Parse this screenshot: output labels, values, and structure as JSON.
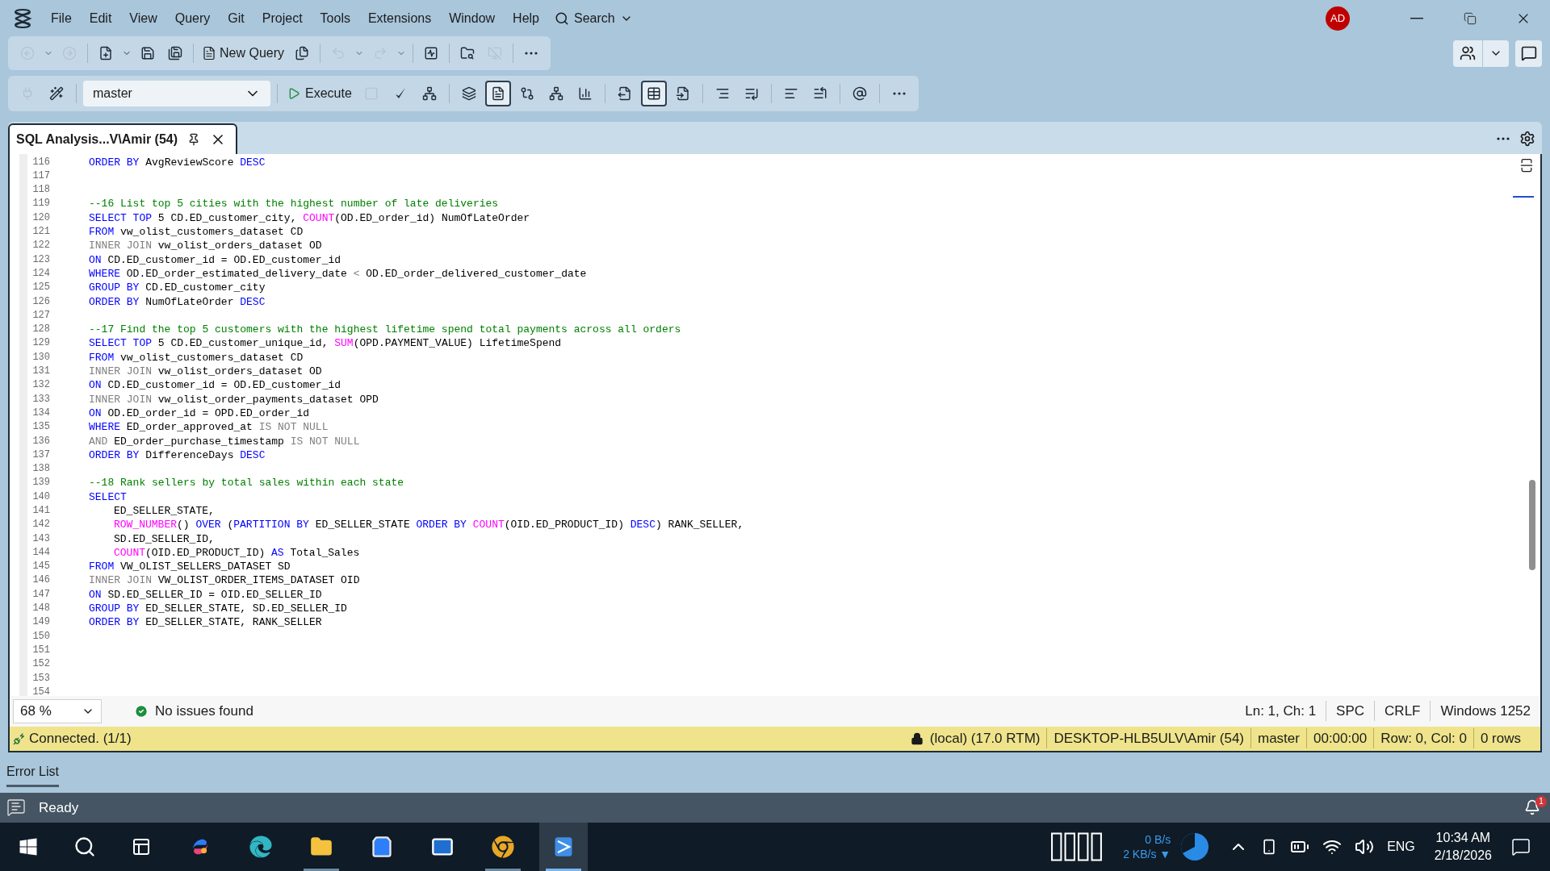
{
  "menu": [
    "File",
    "Edit",
    "View",
    "Query",
    "Git",
    "Project",
    "Tools",
    "Extensions",
    "Window",
    "Help"
  ],
  "search_label": "Search",
  "avatar": "AD",
  "main_toolbar": {
    "tools_before": [
      {
        "disabled": true
      },
      {
        "disabled": true
      },
      {
        "disabled": true
      },
      {
        "disabled": false
      },
      {
        "disabled": false
      },
      {
        "disabled": false
      },
      {
        "disabled": false
      }
    ],
    "new_query": "New Query",
    "tools_after": [
      {
        "disabled": false
      },
      {
        "disabled": true
      },
      {
        "disabled": true
      },
      {
        "disabled": true
      },
      {
        "disabled": true
      },
      {
        "disabled": false
      },
      {
        "disabled": false
      },
      {
        "disabled": true
      },
      {
        "disabled": false
      }
    ]
  },
  "query_toolbar": {
    "leading_tools": [
      {
        "disabled": true
      },
      {
        "disabled": false
      }
    ],
    "database": "master",
    "execute": "Execute",
    "tools": [
      {
        "selected": false,
        "disabled": true
      },
      {
        "selected": false,
        "disabled": false
      },
      {
        "selected": false,
        "disabled": false
      },
      {
        "selected": false,
        "disabled": false
      },
      {
        "selected": true,
        "disabled": false
      },
      {
        "selected": false,
        "disabled": false
      },
      {
        "selected": false,
        "disabled": false
      },
      {
        "selected": false,
        "disabled": false
      },
      {
        "selected": false,
        "disabled": false
      },
      {
        "selected": true,
        "disabled": false
      },
      {
        "selected": false,
        "disabled": false
      },
      {
        "selected": false,
        "disabled": false
      },
      {
        "selected": false,
        "disabled": false
      },
      {
        "selected": false,
        "disabled": false
      },
      {
        "selected": false,
        "disabled": false
      },
      {
        "selected": false,
        "disabled": false
      },
      {
        "selected": false,
        "disabled": false
      }
    ]
  },
  "tab": {
    "title": "SQL Analysis...V\\Amir (54)",
    "selected": true
  },
  "editor": {
    "lines": [
      {
        "number": "116",
        "tokens": [
          {
            "kind": "keyword",
            "text": "ORDER BY"
          },
          {
            "kind": "text",
            "text": " AvgReviewScore "
          },
          {
            "kind": "keyword",
            "text": "DESC"
          }
        ]
      },
      {
        "number": "117"
      },
      {
        "number": "118"
      },
      {
        "number": "119",
        "tokens": [
          {
            "kind": "comment",
            "text": "--16 List top 5 cities with the highest number of late deliveries"
          }
        ]
      },
      {
        "number": "120",
        "tokens": [
          {
            "kind": "keyword",
            "text": "SELECT TOP"
          },
          {
            "kind": "text",
            "text": " 5 CD.ED_customer_city, "
          },
          {
            "kind": "function",
            "text": "COUNT"
          },
          {
            "kind": "text",
            "text": "(OD.ED_order_id) NumOfLateOrder"
          }
        ]
      },
      {
        "number": "121",
        "tokens": [
          {
            "kind": "keyword",
            "text": "FROM"
          },
          {
            "kind": "text",
            "text": " vw_olist_customers_dataset CD"
          }
        ]
      },
      {
        "number": "122",
        "tokens": [
          {
            "kind": "operator",
            "text": "INNER JOIN"
          },
          {
            "kind": "text",
            "text": " vw_olist_orders_dataset OD"
          }
        ]
      },
      {
        "number": "123",
        "tokens": [
          {
            "kind": "keyword",
            "text": "ON"
          },
          {
            "kind": "text",
            "text": " CD.ED_customer_id = OD.ED_customer_id"
          }
        ]
      },
      {
        "number": "124",
        "tokens": [
          {
            "kind": "keyword",
            "text": "WHERE"
          },
          {
            "kind": "text",
            "text": " OD.ED_order_estimated_delivery_date "
          },
          {
            "kind": "operator",
            "text": "<"
          },
          {
            "kind": "text",
            "text": " OD.ED_order_delivered_customer_date"
          }
        ]
      },
      {
        "number": "125",
        "tokens": [
          {
            "kind": "keyword",
            "text": "GROUP BY"
          },
          {
            "kind": "text",
            "text": " CD.ED_customer_city"
          }
        ]
      },
      {
        "number": "126",
        "tokens": [
          {
            "kind": "keyword",
            "text": "ORDER BY"
          },
          {
            "kind": "text",
            "text": " NumOfLateOrder "
          },
          {
            "kind": "keyword",
            "text": "DESC"
          }
        ]
      },
      {
        "number": "127"
      },
      {
        "number": "128",
        "tokens": [
          {
            "kind": "comment",
            "text": "--17 Find the top 5 customers with the highest lifetime spend total payments across all orders"
          }
        ]
      },
      {
        "number": "129",
        "tokens": [
          {
            "kind": "keyword",
            "text": "SELECT TOP"
          },
          {
            "kind": "text",
            "text": " 5 CD.ED_customer_unique_id, "
          },
          {
            "kind": "function",
            "text": "SUM"
          },
          {
            "kind": "text",
            "text": "(OPD.PAYMENT_VALUE) LifetimeSpend"
          }
        ]
      },
      {
        "number": "130",
        "tokens": [
          {
            "kind": "keyword",
            "text": "FROM"
          },
          {
            "kind": "text",
            "text": " vw_olist_customers_dataset CD"
          }
        ]
      },
      {
        "number": "131",
        "tokens": [
          {
            "kind": "operator",
            "text": "INNER JOIN"
          },
          {
            "kind": "text",
            "text": " vw_olist_orders_dataset OD"
          }
        ]
      },
      {
        "number": "132",
        "tokens": [
          {
            "kind": "keyword",
            "text": "ON"
          },
          {
            "kind": "text",
            "text": " CD.ED_customer_id = OD.ED_customer_id"
          }
        ]
      },
      {
        "number": "133",
        "tokens": [
          {
            "kind": "operator",
            "text": "INNER JOIN"
          },
          {
            "kind": "text",
            "text": " vw_olist_order_payments_dataset OPD"
          }
        ]
      },
      {
        "number": "134",
        "tokens": [
          {
            "kind": "keyword",
            "text": "ON"
          },
          {
            "kind": "text",
            "text": " OD.ED_order_id = OPD.ED_order_id"
          }
        ]
      },
      {
        "number": "135",
        "tokens": [
          {
            "kind": "keyword",
            "text": "WHERE"
          },
          {
            "kind": "text",
            "text": " ED_order_approved_at "
          },
          {
            "kind": "operator",
            "text": "IS NOT NULL"
          }
        ]
      },
      {
        "number": "136",
        "tokens": [
          {
            "kind": "operator",
            "text": "AND"
          },
          {
            "kind": "text",
            "text": " ED_order_purchase_timestamp "
          },
          {
            "kind": "operator",
            "text": "IS NOT NULL"
          }
        ]
      },
      {
        "number": "137",
        "tokens": [
          {
            "kind": "keyword",
            "text": "ORDER BY"
          },
          {
            "kind": "text",
            "text": " DifferenceDays "
          },
          {
            "kind": "keyword",
            "text": "DESC"
          }
        ]
      },
      {
        "number": "138"
      },
      {
        "number": "139",
        "tokens": [
          {
            "kind": "comment",
            "text": "--18 Rank sellers by total sales within each state"
          }
        ]
      },
      {
        "number": "140",
        "tokens": [
          {
            "kind": "keyword",
            "text": "SELECT"
          }
        ]
      },
      {
        "number": "141",
        "indented": true,
        "tokens": [
          {
            "kind": "text",
            "text": "ED_SELLER_STATE,"
          }
        ]
      },
      {
        "number": "142",
        "indented": true,
        "tokens": [
          {
            "kind": "function",
            "text": "ROW_NUMBER"
          },
          {
            "kind": "text",
            "text": "() "
          },
          {
            "kind": "keyword",
            "text": "OVER"
          },
          {
            "kind": "text",
            "text": " ("
          },
          {
            "kind": "keyword",
            "text": "PARTITION BY"
          },
          {
            "kind": "text",
            "text": " ED_SELLER_STATE "
          },
          {
            "kind": "keyword",
            "text": "ORDER BY"
          },
          {
            "kind": "function",
            "text": " COUNT"
          },
          {
            "kind": "text",
            "text": "(OID.ED_PRODUCT_ID) "
          },
          {
            "kind": "keyword",
            "text": "DESC"
          },
          {
            "kind": "text",
            "text": ") RANK_SELLER,"
          }
        ]
      },
      {
        "number": "143",
        "indented": true,
        "tokens": [
          {
            "kind": "text",
            "text": "SD.ED_SELLER_ID,"
          }
        ]
      },
      {
        "number": "144",
        "indented": true,
        "tokens": [
          {
            "kind": "function",
            "text": "COUNT"
          },
          {
            "kind": "text",
            "text": "(OID.ED_PRODUCT_ID) "
          },
          {
            "kind": "keyword",
            "text": "AS"
          },
          {
            "kind": "text",
            "text": " Total_Sales"
          }
        ]
      },
      {
        "number": "145",
        "tokens": [
          {
            "kind": "keyword",
            "text": "FROM"
          },
          {
            "kind": "text",
            "text": " VW_OLIST_SELLERS_DATASET SD"
          }
        ]
      },
      {
        "number": "146",
        "tokens": [
          {
            "kind": "operator",
            "text": "INNER JOIN"
          },
          {
            "kind": "text",
            "text": " VW_OLIST_ORDER_ITEMS_DATASET OID"
          }
        ]
      },
      {
        "number": "147",
        "tokens": [
          {
            "kind": "keyword",
            "text": "ON"
          },
          {
            "kind": "text",
            "text": " SD.ED_SELLER_ID = OID.ED_SELLER_ID"
          }
        ]
      },
      {
        "number": "148",
        "tokens": [
          {
            "kind": "keyword",
            "text": "GROUP BY"
          },
          {
            "kind": "text",
            "text": " ED_SELLER_STATE, SD.ED_SELLER_ID"
          }
        ]
      },
      {
        "number": "149",
        "tokens": [
          {
            "kind": "keyword",
            "text": "ORDER BY"
          },
          {
            "kind": "text",
            "text": " ED_SELLER_STATE, RANK_SELLER"
          }
        ]
      },
      {
        "number": "150"
      },
      {
        "number": "151"
      },
      {
        "number": "152"
      },
      {
        "number": "153"
      },
      {
        "number": "154"
      }
    ]
  },
  "editor_status": {
    "zoom": "68 %",
    "issues": "No issues found",
    "position": "Ln: 1, Ch: 1",
    "indent": "SPC",
    "line_ending": "CRLF",
    "encoding": "Windows 1252"
  },
  "connection_bar": {
    "status": "Connected. (1/1)",
    "server": "(local) (17.0 RTM)",
    "user": "DESKTOP-HLB5ULV\\Amir (54)",
    "database": "master",
    "elapsed": "00:00:00",
    "row_col": "Row: 0, Col: 0",
    "rows": "0 rows"
  },
  "panel_tab": {
    "label": "Error List",
    "selected": true
  },
  "status_bar": {
    "text": "Ready",
    "notifications": "1"
  },
  "taskbar": {
    "apps": [
      {
        "running": false,
        "selected": false
      },
      {
        "running": false,
        "selected": false
      },
      {
        "running": true,
        "selected": false
      },
      {
        "running": false,
        "selected": false
      },
      {
        "running": false,
        "selected": false
      },
      {
        "running": true,
        "selected": false
      },
      {
        "running": true,
        "selected": true
      }
    ],
    "network_up": "0 B/s",
    "network_down": "2 KB/s ▼",
    "language": "ENG",
    "time": "10:34 AM",
    "date": "2/18/2026"
  }
}
